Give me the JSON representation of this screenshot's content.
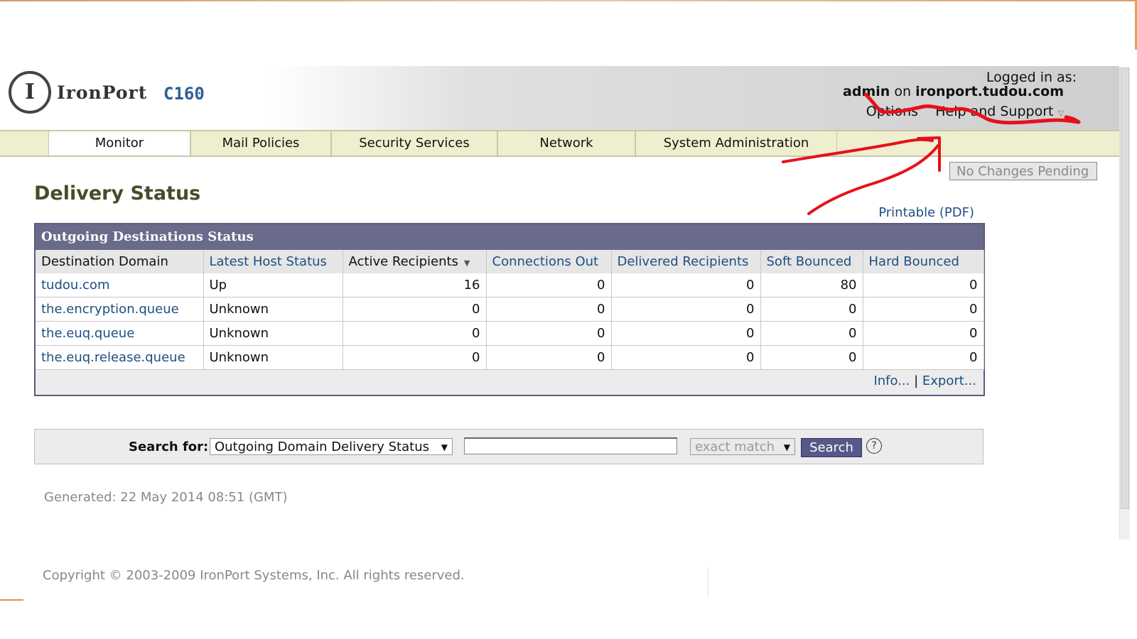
{
  "header": {
    "logo_icon": "ironport-logo-icon",
    "brand": "IronPort",
    "model": "C160",
    "login_label": "Logged in as:",
    "user": "admin",
    "on_word": "on",
    "host": "ironport.tudou.com",
    "options_label": "Options",
    "help_label": "Help and Support"
  },
  "nav": {
    "tabs": [
      "Monitor",
      "Mail Policies",
      "Security Services",
      "Network",
      "System Administration"
    ],
    "active": "Monitor"
  },
  "pending_button": "No Changes Pending",
  "page_title": "Delivery Status",
  "printable_link": "Printable (PDF)",
  "table": {
    "title": "Outgoing Destinations Status",
    "columns": [
      "Destination Domain",
      "Latest Host Status",
      "Active Recipients",
      "Connections Out",
      "Delivered Recipients",
      "Soft Bounced",
      "Hard Bounced"
    ],
    "rows": [
      [
        "tudou.com",
        "Up",
        "16",
        "0",
        "0",
        "80",
        "0"
      ],
      [
        "the.encryption.queue",
        "Unknown",
        "0",
        "0",
        "0",
        "0",
        "0"
      ],
      [
        "the.euq.queue",
        "Unknown",
        "0",
        "0",
        "0",
        "0",
        "0"
      ],
      [
        "the.euq.release.queue",
        "Unknown",
        "0",
        "0",
        "0",
        "0",
        "0"
      ]
    ],
    "footer_info": "Info...",
    "footer_sep": "|",
    "footer_export": "Export..."
  },
  "search": {
    "label": "Search for:",
    "scope_value": "Outgoing Domain Delivery Status",
    "query_value": "",
    "match_value": "exact match",
    "button": "Search",
    "help_icon": "question-circle-icon"
  },
  "generated": "Generated: 22 May 2014 08:51 (GMT)",
  "copyright": "Copyright © 2003-2009 IronPort Systems, Inc. All rights reserved.",
  "colors": {
    "nav_bg": "#efefcf",
    "table_header": "#6a6a8a",
    "link": "#1e4f82",
    "annotation": "#e8101a"
  }
}
